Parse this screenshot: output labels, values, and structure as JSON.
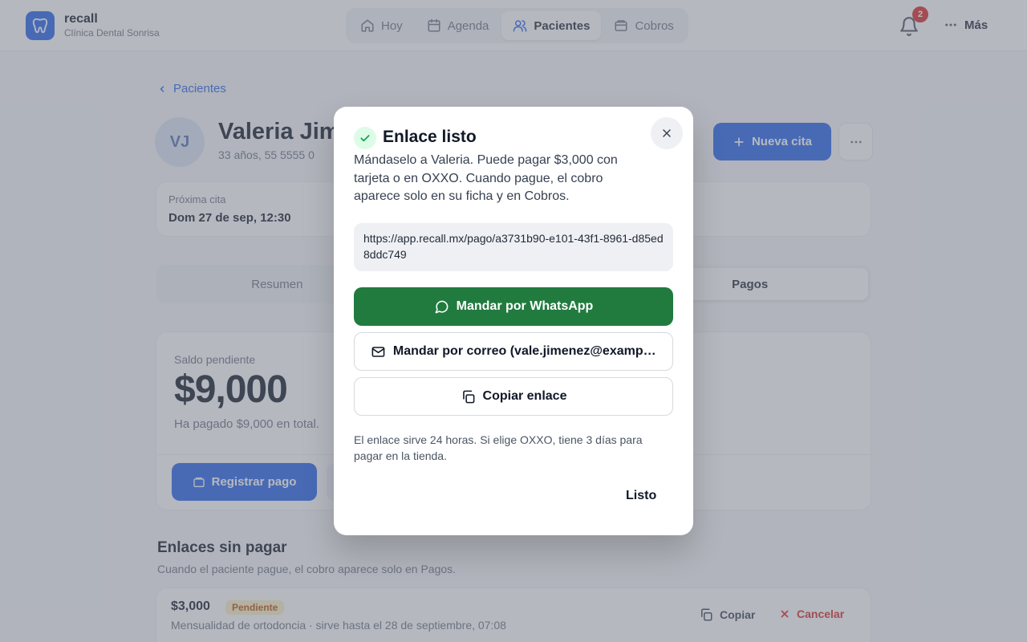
{
  "header": {
    "brand_name": "recall",
    "brand_subtitle": "Clínica Dental Sonrisa",
    "nav": [
      {
        "label": "Hoy",
        "icon": "home-icon"
      },
      {
        "label": "Agenda",
        "icon": "calendar-icon"
      },
      {
        "label": "Pacientes",
        "icon": "users-icon",
        "active": true
      },
      {
        "label": "Cobros",
        "icon": "receipt-icon"
      }
    ],
    "notifications_count": "2",
    "more_label": "Más"
  },
  "page": {
    "back_label": "Pacientes",
    "patient": {
      "initials": "VJ",
      "name": "Valeria Jim",
      "meta": "33 años, 55 5555 0"
    },
    "new_appointment_label": "Nueva cita",
    "next_appointment": {
      "label": "Próxima cita",
      "value": "Dom 27 de sep, 12:30"
    },
    "tabs": [
      {
        "label": "Resumen"
      },
      {
        "label": "Pagos",
        "active": true
      }
    ],
    "balance": {
      "label": "Saldo pendiente",
      "amount": "$9,000",
      "paid_note": "Ha pagado $9,000 en total.",
      "register_label": "Registrar pago"
    },
    "pending_links": {
      "title": "Enlaces sin pagar",
      "subtitle": "Cuando el paciente pague, el cobro aparece solo en Pagos.",
      "items": [
        {
          "amount": "$3,000",
          "status": "Pendiente",
          "description": "Mensualidad de ortodoncia · sirve hasta el 28 de septiembre, 07:08",
          "copy_label": "Copiar",
          "cancel_label": "Cancelar"
        }
      ]
    }
  },
  "modal": {
    "title": "Enlace listo",
    "description": "Mándaselo a Valeria. Puede pagar $3,000 con tarjeta o en OXXO. Cuando pague, el cobro aparece solo en su ficha y en Cobros.",
    "url": "https://app.recall.mx/pago/a3731b90-e101-43f1-8961-d85ed8ddc749",
    "whatsapp_label": "Mandar por WhatsApp",
    "email_label": "Mandar por correo (vale.jimenez@exampl...",
    "copy_label": "Copiar enlace",
    "note": "El enlace sirve 24 horas. Si elige OXXO, tiene 3 días para pagar en la tienda.",
    "done_label": "Listo"
  },
  "colors": {
    "primary": "#2563eb",
    "whatsapp_green": "#217b3f",
    "success_bg": "#dcfce7",
    "danger": "#dc2626",
    "overlay": "rgba(107,114,128,0.5)"
  }
}
